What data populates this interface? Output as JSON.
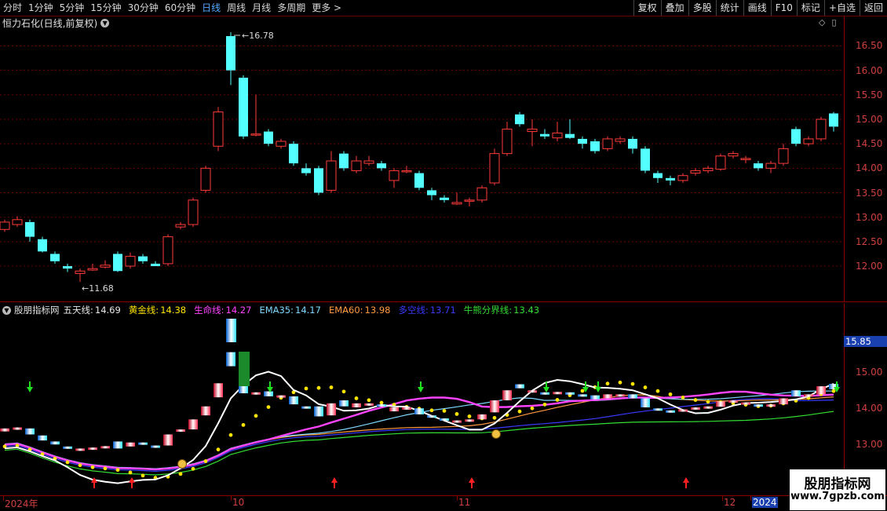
{
  "toolbar": {
    "periods": [
      "分时",
      "1分钟",
      "5分钟",
      "15分钟",
      "30分钟",
      "60分钟",
      "日线",
      "周线",
      "月线",
      "多周期",
      "更多 >"
    ],
    "active_period": "日线",
    "buttons": [
      "复权",
      "叠加",
      "多股",
      "统计",
      "画线",
      "F10",
      "标记",
      "+自选",
      "返回"
    ]
  },
  "stock": {
    "title": "恒力石化(日线,前复权)",
    "high_label": "16.78",
    "low_label": "11.68"
  },
  "price_axis": {
    "ticks": [
      "16.50",
      "16.00",
      "15.50",
      "15.00",
      "14.50",
      "14.00",
      "13.50",
      "13.00",
      "12.50",
      "12.00"
    ]
  },
  "indicator": {
    "name": "股朋指标网",
    "lines": [
      {
        "label": "五天线:",
        "value": "14.69",
        "color": "#e8e8e8"
      },
      {
        "label": "黄金线:",
        "value": "14.38",
        "color": "#ffe400"
      },
      {
        "label": "生命线:",
        "value": "14.27",
        "color": "#ff44ff"
      },
      {
        "label": "EMA35:",
        "value": "14.17",
        "color": "#7fd8ff"
      },
      {
        "label": "EMA60:",
        "value": "13.98",
        "color": "#ff9a40"
      },
      {
        "label": "多空线:",
        "value": "13.71",
        "color": "#3a3aff"
      },
      {
        "label": "牛熊分界线:",
        "value": "13.43",
        "color": "#33dd33"
      }
    ],
    "axis_ticks": [
      "15.00",
      "14.00",
      "13.00"
    ],
    "current": "15.85"
  },
  "dates": {
    "labels": [
      "2024年",
      "10",
      "11",
      "12",
      "2024"
    ]
  },
  "watermark": {
    "title": "股朋指标网",
    "url": "www.7gpzb.com"
  },
  "colors": {
    "up": "#ff3b3b",
    "down": "#54ffff",
    "axis": "#d04040",
    "grid": "#6b0000"
  },
  "icons": [
    "chevron-down-icon",
    "diamond-icon",
    "panel-icon",
    "arrow-up-icon",
    "arrow-down-icon",
    "money-bag-icon"
  ]
}
